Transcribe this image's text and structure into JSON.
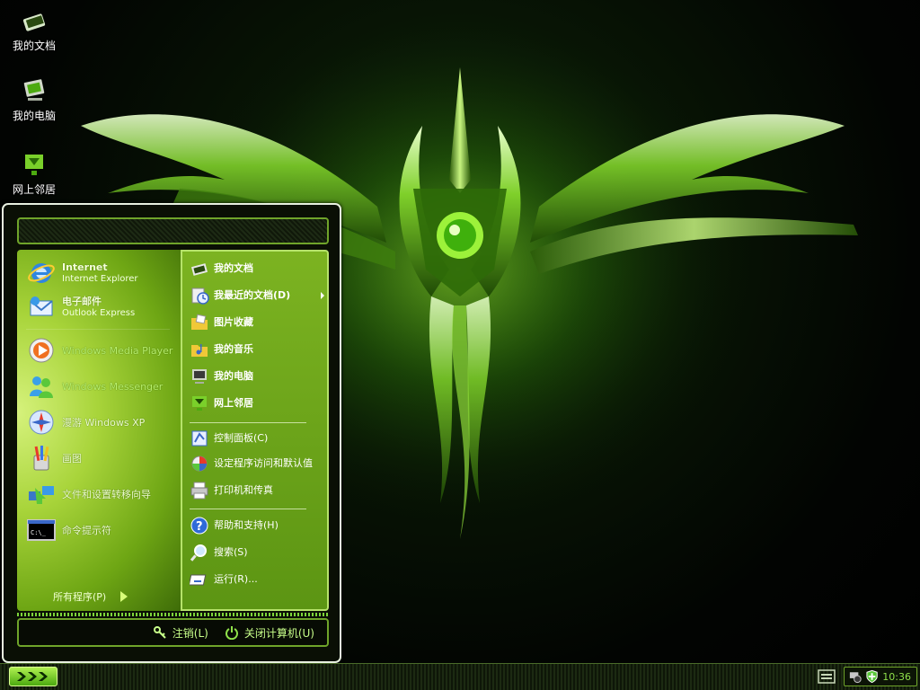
{
  "desktop": {
    "icons": [
      {
        "label": "我的文档",
        "icon": "my-documents-icon"
      },
      {
        "label": "我的电脑",
        "icon": "my-computer-icon"
      },
      {
        "label": "网上邻居",
        "icon": "network-places-icon"
      }
    ]
  },
  "start_menu": {
    "pinned": [
      {
        "title": "Internet",
        "subtitle": "Internet Explorer",
        "icon": "internet-explorer-icon"
      },
      {
        "title": "电子邮件",
        "subtitle": "Outlook Express",
        "icon": "outlook-express-icon"
      }
    ],
    "recent": [
      {
        "label": "Windows Media Player",
        "icon": "media-player-icon"
      },
      {
        "label": "Windows Messenger",
        "icon": "messenger-icon"
      },
      {
        "label": "漫游 Windows XP",
        "icon": "tour-xp-icon"
      },
      {
        "label": "画图",
        "icon": "paint-icon"
      },
      {
        "label": "文件和设置转移向导",
        "icon": "transfer-wizard-icon"
      },
      {
        "label": "命令提示符",
        "icon": "command-prompt-icon"
      }
    ],
    "all_programs": "所有程序(P)",
    "places": [
      {
        "label": "我的文档",
        "icon": "my-documents-icon"
      },
      {
        "label": "我最近的文档(D)",
        "icon": "recent-documents-icon"
      },
      {
        "label": "图片收藏",
        "icon": "my-pictures-icon"
      },
      {
        "label": "我的音乐",
        "icon": "my-music-icon"
      },
      {
        "label": "我的电脑",
        "icon": "my-computer-icon"
      },
      {
        "label": "网上邻居",
        "icon": "network-places-icon"
      }
    ],
    "system": [
      {
        "label": "控制面板(C)",
        "icon": "control-panel-icon"
      },
      {
        "label": "设定程序访问和默认值",
        "icon": "program-access-icon"
      },
      {
        "label": "打印机和传真",
        "icon": "printer-icon"
      }
    ],
    "help": [
      {
        "label": "帮助和支持(H)",
        "icon": "help-icon"
      },
      {
        "label": "搜索(S)",
        "icon": "search-icon"
      },
      {
        "label": "运行(R)...",
        "icon": "run-icon"
      }
    ],
    "logoff": "注销(L)",
    "shutdown": "关闭计算机(U)"
  },
  "taskbar": {
    "clock": "10:36"
  },
  "colors": {
    "accent": "#8fe04a",
    "menu_green": "#6ea614"
  }
}
